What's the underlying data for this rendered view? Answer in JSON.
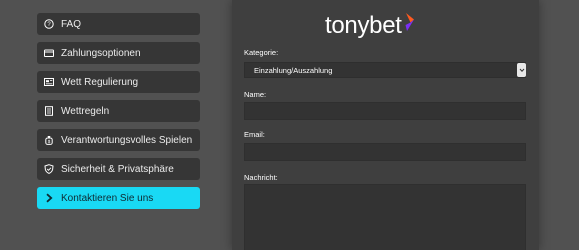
{
  "sidebar": {
    "items": [
      {
        "label": "FAQ",
        "icon": "help-circle-icon",
        "active": false
      },
      {
        "label": "Zahlungsoptionen",
        "icon": "credit-card-icon",
        "active": false
      },
      {
        "label": "Wett Regulierung",
        "icon": "regulation-card-icon",
        "active": false
      },
      {
        "label": "Wettregeln",
        "icon": "rules-document-icon",
        "active": false
      },
      {
        "label": "Verantwortungsvolles Spielen",
        "icon": "money-bag-icon",
        "active": false
      },
      {
        "label": "Sicherheit & Privatsphäre",
        "icon": "shield-icon",
        "active": false
      },
      {
        "label": "Kontaktieren Sie uns",
        "icon": "chevron-right-icon",
        "active": true
      }
    ]
  },
  "brand": {
    "name": "tonybet",
    "accent_colors": [
      "#ff5a1f",
      "#7b2ff7"
    ]
  },
  "form": {
    "category_label": "Kategorie:",
    "category_value": "Einzahlung/Auszahlung",
    "name_label": "Name:",
    "name_value": "",
    "email_label": "Email:",
    "email_value": "",
    "message_label": "Nachricht:",
    "message_value": ""
  },
  "colors": {
    "background": "#515151",
    "panel": "#3f3f3f",
    "nav_item": "#363636",
    "active_accent": "#19d9f4"
  }
}
